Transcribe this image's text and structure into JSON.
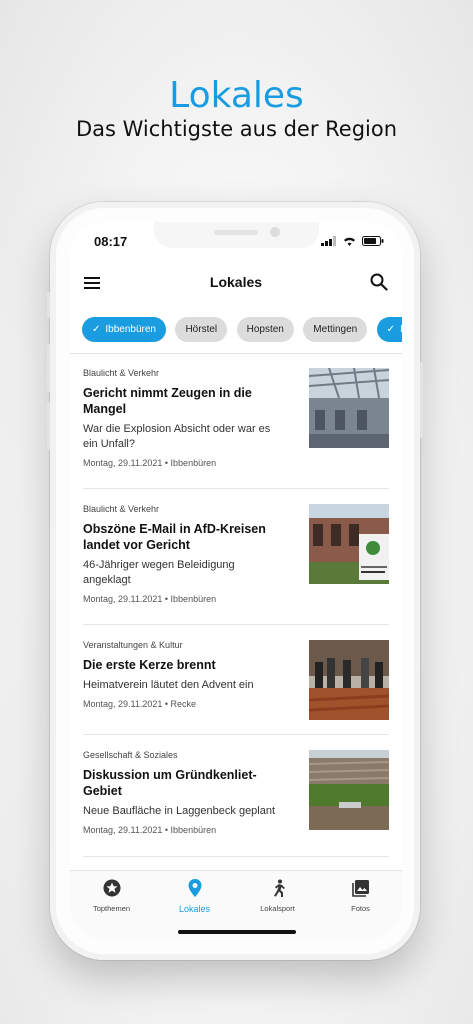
{
  "promo": {
    "title": "Lokales",
    "subtitle": "Das Wichtigste aus der Region"
  },
  "status": {
    "time": "08:17"
  },
  "appbar": {
    "title": "Lokales"
  },
  "chips": [
    {
      "label": "Ibbenbüren",
      "selected": true
    },
    {
      "label": "Hörstel",
      "selected": false
    },
    {
      "label": "Hopsten",
      "selected": false
    },
    {
      "label": "Mettingen",
      "selected": false
    },
    {
      "label": "Re",
      "selected": true
    }
  ],
  "articles": [
    {
      "category": "Blaulicht & Verkehr",
      "headline": "Gericht nimmt Zeugen in die Mangel",
      "teaser": "War die Explosion Absicht oder war es ein Unfall?",
      "meta": "Montag, 29.11.2021 • Ibbenbüren"
    },
    {
      "category": "Blaulicht & Verkehr",
      "headline": "Obszöne E-Mail in AfD-Kreisen landet vor Gericht",
      "teaser": "46-Jähriger wegen Beleidigung angeklagt",
      "meta": "Montag, 29.11.2021 • Ibbenbüren"
    },
    {
      "category": "Veranstaltungen & Kultur",
      "headline": "Die erste Kerze brennt",
      "teaser": "Heimatverein läutet den Advent ein",
      "meta": "Montag, 29.11.2021 • Recke"
    },
    {
      "category": "Gesellschaft & Soziales",
      "headline": "Diskussion um Gründkenliet-Gebiet",
      "teaser": "Neue Baufläche in Laggenbeck geplant",
      "meta": "Montag, 29.11.2021 • Ibbenbüren"
    }
  ],
  "tabs": [
    {
      "label": "Topthemen",
      "icon": "star-icon",
      "active": false
    },
    {
      "label": "Lokales",
      "icon": "location-pin-icon",
      "active": true
    },
    {
      "label": "Lokalsport",
      "icon": "runner-icon",
      "active": false
    },
    {
      "label": "Fotos",
      "icon": "photos-icon",
      "active": false
    }
  ],
  "colors": {
    "accent": "#1a9de0",
    "chip_inactive": "#dcdcdc"
  }
}
